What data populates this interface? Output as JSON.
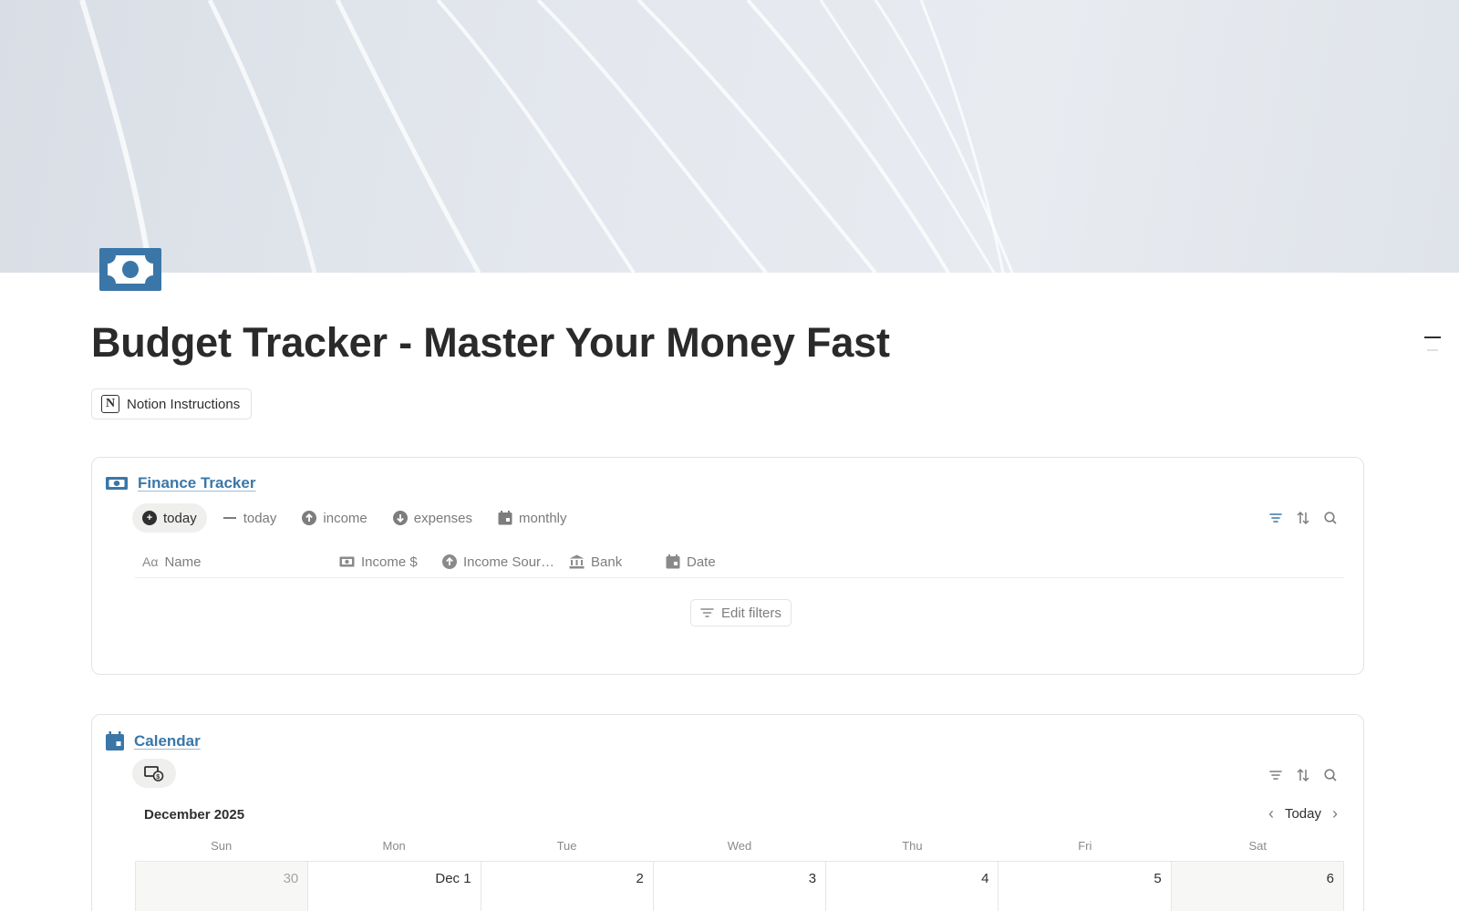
{
  "page": {
    "title": "Budget Tracker - Master Your Money Fast",
    "icon": "dollar-bill-icon",
    "accent_color": "#3a77a8"
  },
  "links": {
    "notion_instructions": "Notion Instructions"
  },
  "finance_tracker": {
    "title": "Finance Tracker",
    "tabs": [
      {
        "label": "today",
        "icon": "plus-circle-icon"
      },
      {
        "label": "today",
        "icon": "minus-icon"
      },
      {
        "label": "income",
        "icon": "arrow-up-circle-icon"
      },
      {
        "label": "expenses",
        "icon": "arrow-down-circle-icon"
      },
      {
        "label": "monthly",
        "icon": "calendar-icon"
      }
    ],
    "columns": [
      {
        "label": "Name",
        "icon": "text-icon"
      },
      {
        "label": "Income $",
        "icon": "money-icon"
      },
      {
        "label": "Income Sour…",
        "icon": "arrow-up-circle-icon"
      },
      {
        "label": "Bank",
        "icon": "bank-icon"
      },
      {
        "label": "Date",
        "icon": "calendar-icon"
      }
    ],
    "edit_filters": "Edit filters"
  },
  "calendar": {
    "title": "Calendar",
    "month": "December 2025",
    "today_label": "Today",
    "weekdays": [
      "Sun",
      "Mon",
      "Tue",
      "Wed",
      "Thu",
      "Fri",
      "Sat"
    ],
    "days": [
      "30",
      "Dec 1",
      "2",
      "3",
      "4",
      "5",
      "6"
    ]
  }
}
